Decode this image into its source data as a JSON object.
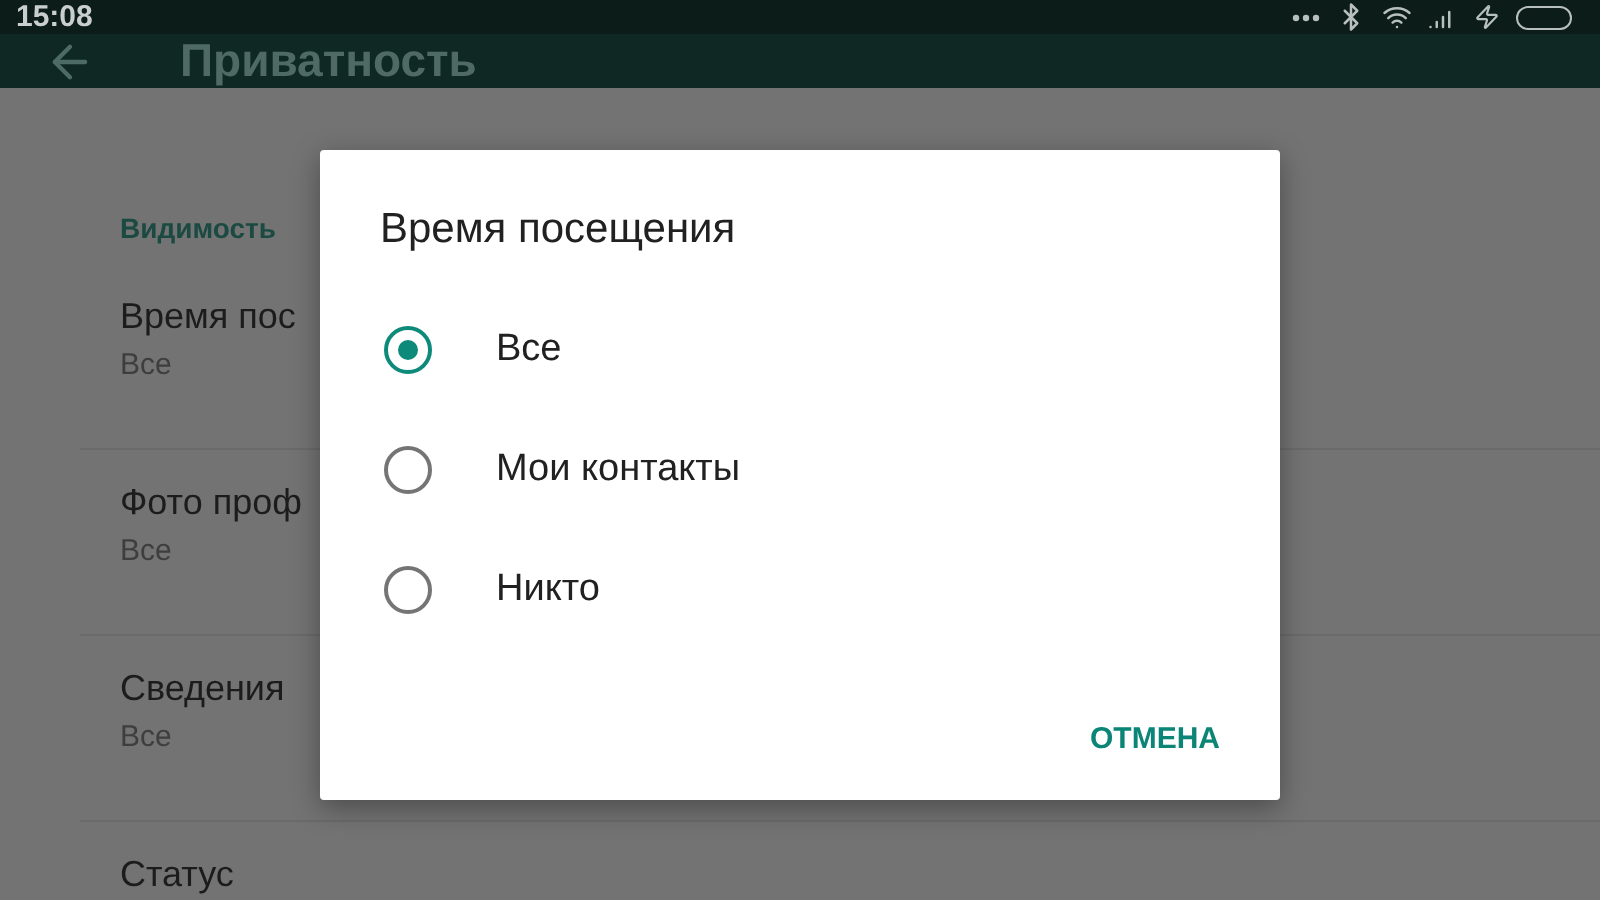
{
  "status_bar": {
    "time": "15:08"
  },
  "app_bar": {
    "title": "Приватность"
  },
  "list": {
    "section": "Видимость",
    "items": [
      {
        "title": "Время пос",
        "value": "Все"
      },
      {
        "title": "Фото проф",
        "value": "Все"
      },
      {
        "title": "Сведения",
        "value": "Все"
      },
      {
        "title": "Статус"
      }
    ]
  },
  "dialog": {
    "title": "Время посещения",
    "options": [
      {
        "label": "Все",
        "selected": true
      },
      {
        "label": "Мои контакты",
        "selected": false
      },
      {
        "label": "Никто",
        "selected": false
      }
    ],
    "buttons": [
      "ОТМЕНА"
    ]
  }
}
